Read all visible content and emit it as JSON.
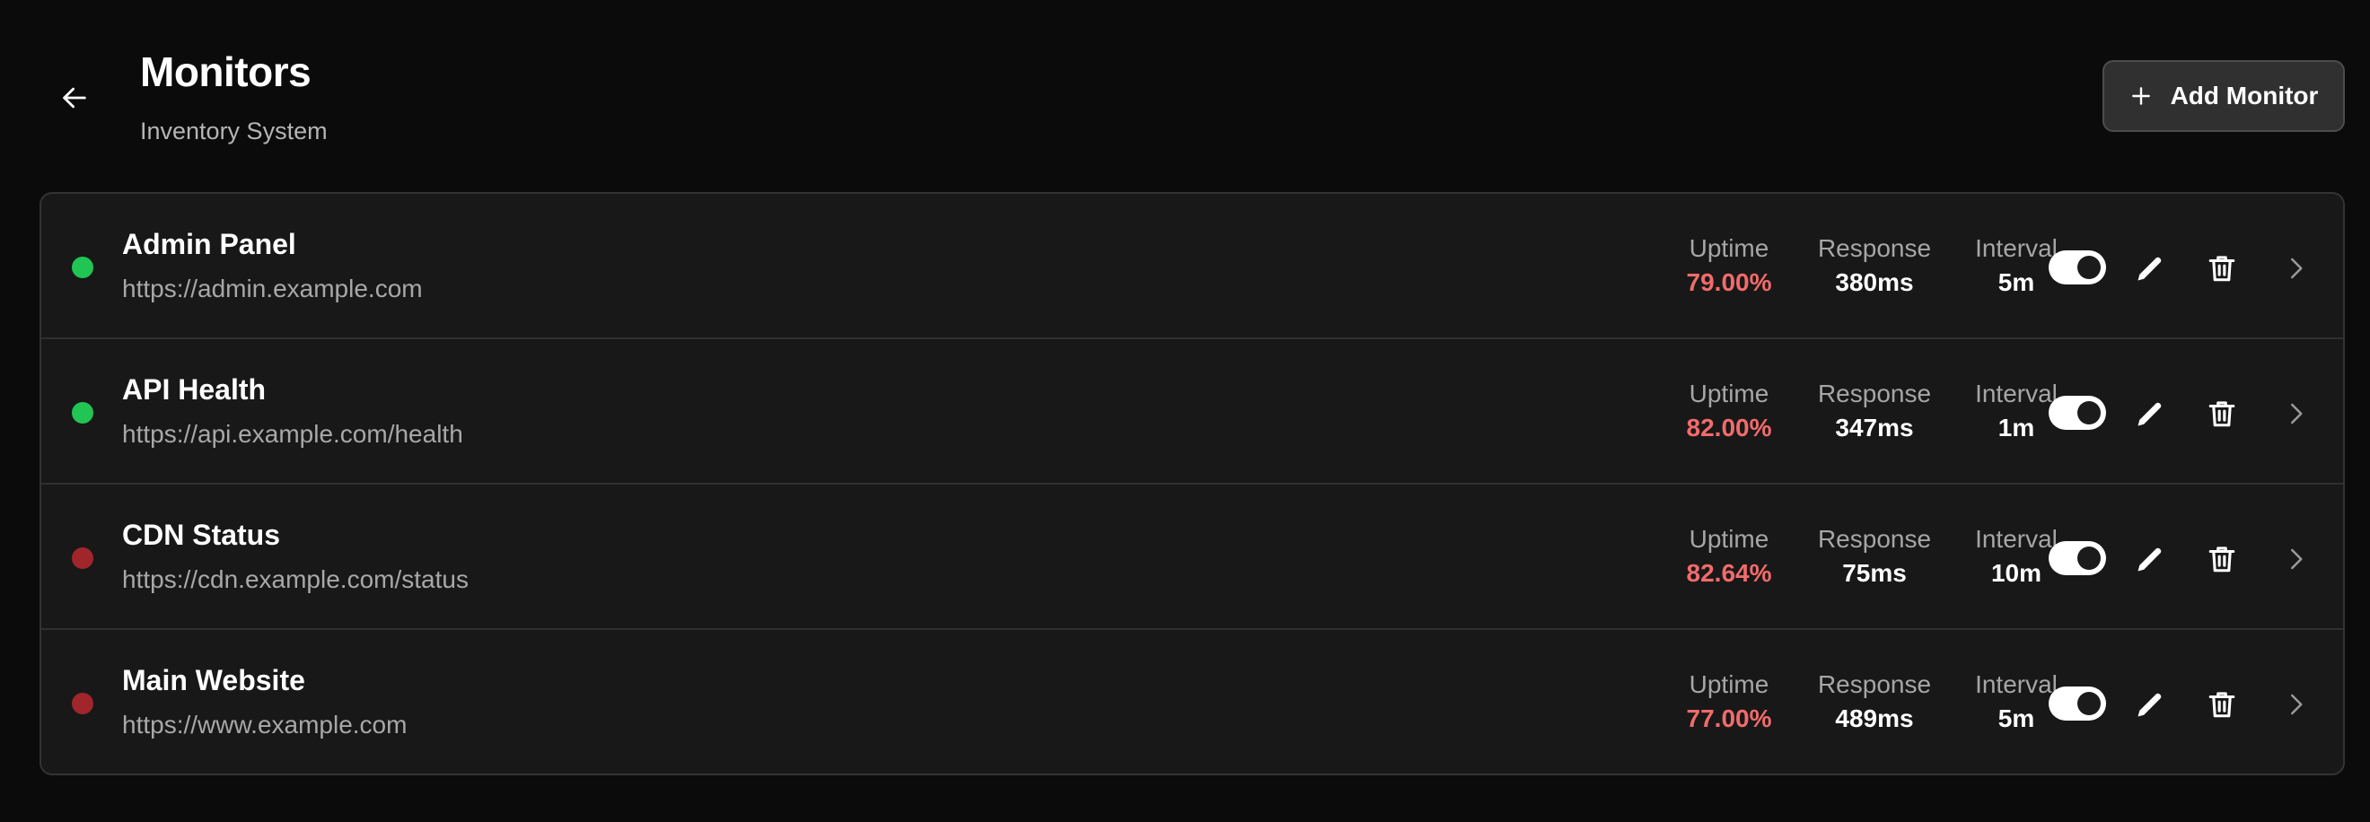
{
  "header": {
    "title": "Monitors",
    "subtitle": "Inventory System",
    "add_button_label": "Add Monitor",
    "back_icon": "arrow-left-icon",
    "add_icon": "plus-icon"
  },
  "colors": {
    "status_up": "#21c553",
    "status_down": "#a0262c",
    "uptime_value": "#f26b6b"
  },
  "stat_labels": {
    "uptime": "Uptime",
    "response": "Response",
    "interval": "Interval"
  },
  "monitors": [
    {
      "name": "Admin Panel",
      "url": "https://admin.example.com",
      "status": "up",
      "uptime": "79.00%",
      "response": "380ms",
      "interval": "5m",
      "enabled": true
    },
    {
      "name": "API Health",
      "url": "https://api.example.com/health",
      "status": "up",
      "uptime": "82.00%",
      "response": "347ms",
      "interval": "1m",
      "enabled": true
    },
    {
      "name": "CDN Status",
      "url": "https://cdn.example.com/status",
      "status": "down",
      "uptime": "82.64%",
      "response": "75ms",
      "interval": "10m",
      "enabled": true
    },
    {
      "name": "Main Website",
      "url": "https://www.example.com",
      "status": "down",
      "uptime": "77.00%",
      "response": "489ms",
      "interval": "5m",
      "enabled": true
    }
  ]
}
